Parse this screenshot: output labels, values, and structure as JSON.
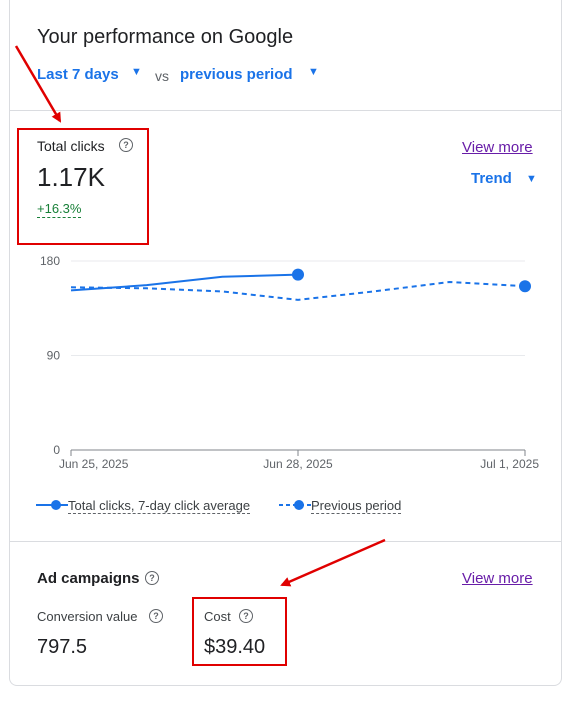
{
  "header": {
    "title": "Your performance on Google",
    "period_label": "Last 7 days",
    "vs_label": "vs",
    "compare_label": "previous period"
  },
  "clicks": {
    "label": "Total clicks",
    "value": "1.17K",
    "delta": "+16.3%",
    "view_more": "View more",
    "trend_label": "Trend"
  },
  "chart_data": {
    "type": "line",
    "x_ticks": [
      "Jun 25, 2025",
      "Jun 28, 2025",
      "Jul 1, 2025"
    ],
    "y_ticks": [
      "180",
      "90",
      "0"
    ],
    "ylim": [
      0,
      180
    ],
    "series": [
      {
        "name": "Total clicks, 7-day click average",
        "style": "solid",
        "color": "#1a73e8",
        "x": [
          0,
          1,
          2,
          3
        ],
        "values": [
          152,
          157,
          165,
          167
        ]
      },
      {
        "name": "Previous period",
        "style": "dashed",
        "color": "#1a73e8",
        "x": [
          0,
          1,
          2,
          3,
          4,
          5,
          6
        ],
        "values": [
          155,
          154,
          151,
          143,
          151,
          160,
          156
        ]
      }
    ]
  },
  "campaigns": {
    "title": "Ad campaigns",
    "view_more": "View more",
    "conversion_label": "Conversion value",
    "conversion_value": "797.5",
    "cost_label": "Cost",
    "cost_value": "$39.40"
  },
  "colors": {
    "accent": "#1a73e8",
    "link": "#681da8",
    "positive": "#188038",
    "annotation": "#e00000"
  }
}
